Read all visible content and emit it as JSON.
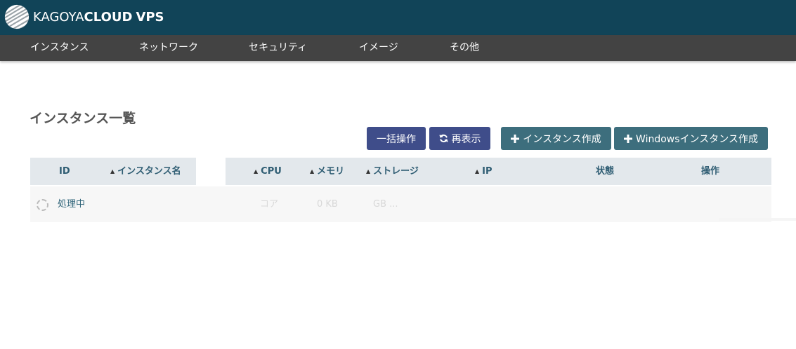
{
  "app": {
    "logo_part1": "KAGOYA",
    "logo_part2": "CLOUD",
    "logo_part3": "VPS"
  },
  "nav": {
    "items": [
      {
        "label": "インスタンス"
      },
      {
        "label": "ネットワーク"
      },
      {
        "label": "セキュリティ"
      },
      {
        "label": "イメージ"
      },
      {
        "label": "その他"
      }
    ]
  },
  "page": {
    "title": "インスタンス一覧"
  },
  "toolbar": {
    "bulk_label": "一括操作",
    "refresh_label": "再表示",
    "create_label": "インスタンス作成",
    "create_windows_label": "Windowsインスタンス作成",
    "refresh_icon": "refresh-icon",
    "plus_icon": "plus-icon"
  },
  "table": {
    "columns": [
      {
        "label": "ID",
        "sortable": false
      },
      {
        "label": "インスタンス名",
        "sortable": true
      },
      {
        "label": "CPU",
        "sortable": true
      },
      {
        "label": "メモリ",
        "sortable": true
      },
      {
        "label": "ストレージ",
        "sortable": true
      },
      {
        "label": "IP",
        "sortable": true
      },
      {
        "label": "状態",
        "sortable": false
      },
      {
        "label": "操作",
        "sortable": false
      }
    ],
    "rows": [
      {
        "status": "処理中",
        "cpu": "コア",
        "memory": "0 KB",
        "storage": "GB ..."
      }
    ]
  },
  "colors": {
    "header_bg": "#114458",
    "nav_bg": "#434343",
    "button_navy": "#3f4d8a",
    "button_teal": "#3d6e7d",
    "table_header_bg": "#e3e8ec",
    "table_header_text": "#2f5d73"
  }
}
